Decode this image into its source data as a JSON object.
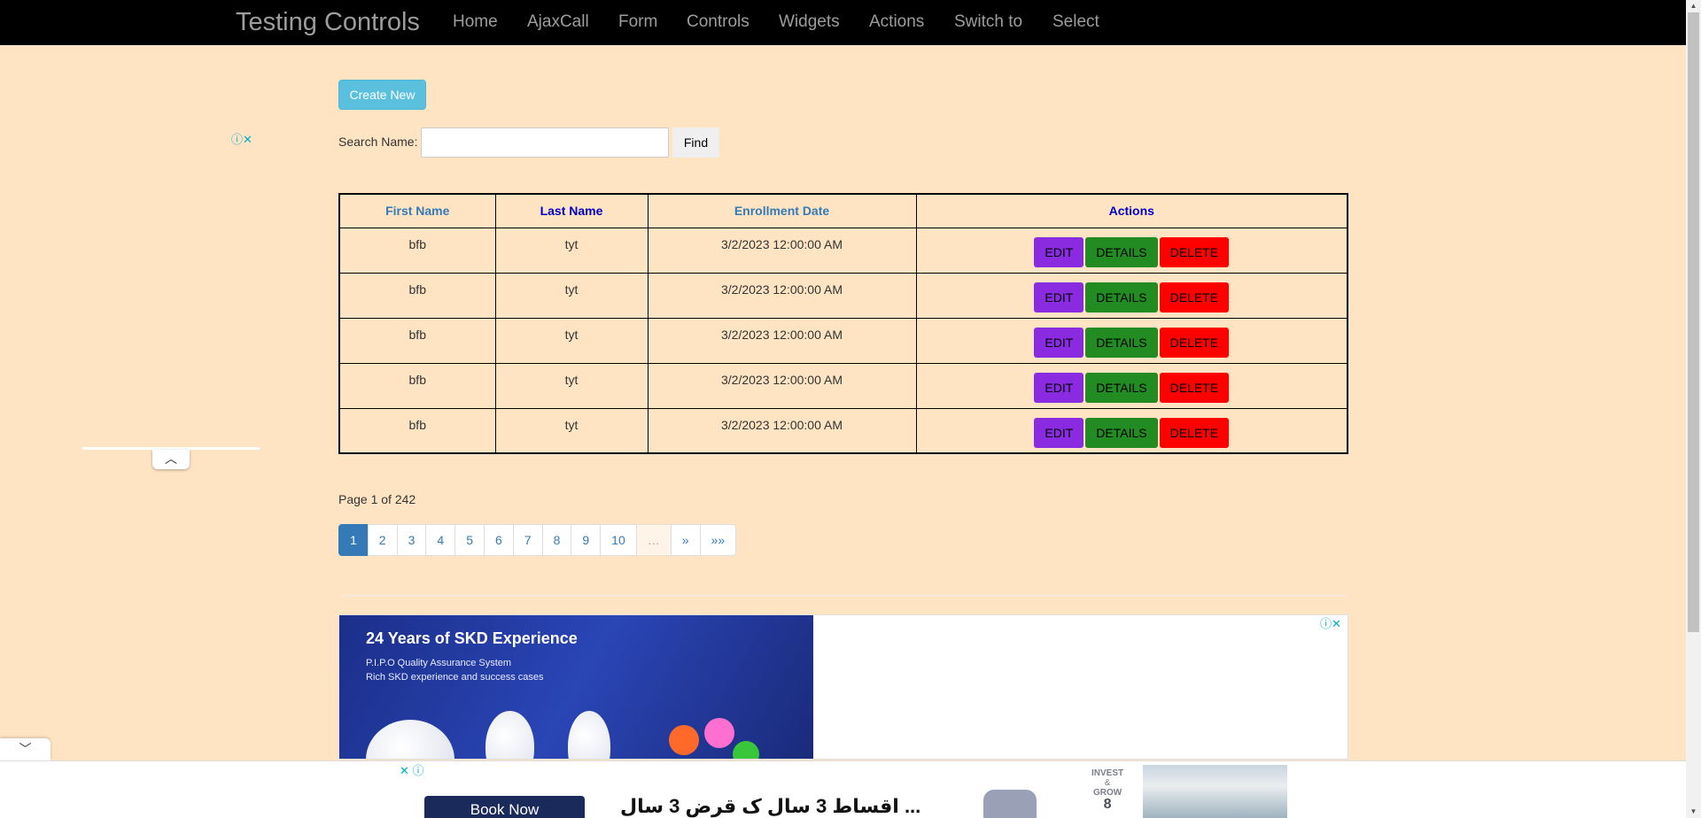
{
  "navbar": {
    "brand": "Testing Controls",
    "items": [
      "Home",
      "AjaxCall",
      "Form",
      "Controls",
      "Widgets",
      "Actions",
      "Switch to",
      "Select"
    ]
  },
  "toolbar": {
    "create_label": "Create New",
    "search_label": "Search Name:",
    "search_value": "",
    "find_label": "Find"
  },
  "table": {
    "headers": [
      "First Name",
      "Last Name",
      "Enrollment Date",
      "Actions"
    ],
    "rows": [
      {
        "first": "bfb",
        "last": "tyt",
        "date": "3/2/2023 12:00:00 AM"
      },
      {
        "first": "bfb",
        "last": "tyt",
        "date": "3/2/2023 12:00:00 AM"
      },
      {
        "first": "bfb",
        "last": "tyt",
        "date": "3/2/2023 12:00:00 AM"
      },
      {
        "first": "bfb",
        "last": "tyt",
        "date": "3/2/2023 12:00:00 AM"
      },
      {
        "first": "bfb",
        "last": "tyt",
        "date": "3/2/2023 12:00:00 AM"
      }
    ],
    "actions": {
      "edit": "EDIT",
      "details": "DETAILS",
      "delete": "DELETE"
    }
  },
  "pagination": {
    "info": "Page 1 of 242",
    "pages": [
      "1",
      "2",
      "3",
      "4",
      "5",
      "6",
      "7",
      "8",
      "9",
      "10",
      "…",
      "»",
      "»»"
    ],
    "current": "1"
  },
  "ads": {
    "choice_icons": "ⓘ✕",
    "banner": {
      "title": "24 Years of SKD Experience",
      "lines": [
        "P.I.P.O Quality Assurance System",
        "Rich SKD experience and success cases"
      ]
    },
    "bottom": {
      "button": "Book Now",
      "arabic": "اقساط 3 سال ک قرض 3 سال ...",
      "invest": [
        "INVEST",
        "&",
        "GROW"
      ],
      "number": "8"
    }
  },
  "icons": {
    "collapse": "chevron-up-icon",
    "expand": "chevron-down-icon"
  }
}
